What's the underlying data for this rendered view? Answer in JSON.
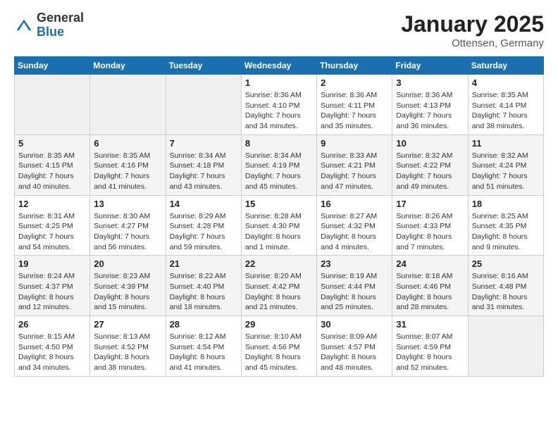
{
  "header": {
    "logo_general": "General",
    "logo_blue": "Blue",
    "title": "January 2025",
    "subtitle": "Ottensen, Germany"
  },
  "weekdays": [
    "Sunday",
    "Monday",
    "Tuesday",
    "Wednesday",
    "Thursday",
    "Friday",
    "Saturday"
  ],
  "weeks": [
    [
      {
        "day": "",
        "info": ""
      },
      {
        "day": "",
        "info": ""
      },
      {
        "day": "",
        "info": ""
      },
      {
        "day": "1",
        "info": "Sunrise: 8:36 AM\nSunset: 4:10 PM\nDaylight: 7 hours\nand 34 minutes."
      },
      {
        "day": "2",
        "info": "Sunrise: 8:36 AM\nSunset: 4:11 PM\nDaylight: 7 hours\nand 35 minutes."
      },
      {
        "day": "3",
        "info": "Sunrise: 8:36 AM\nSunset: 4:13 PM\nDaylight: 7 hours\nand 36 minutes."
      },
      {
        "day": "4",
        "info": "Sunrise: 8:35 AM\nSunset: 4:14 PM\nDaylight: 7 hours\nand 38 minutes."
      }
    ],
    [
      {
        "day": "5",
        "info": "Sunrise: 8:35 AM\nSunset: 4:15 PM\nDaylight: 7 hours\nand 40 minutes."
      },
      {
        "day": "6",
        "info": "Sunrise: 8:35 AM\nSunset: 4:16 PM\nDaylight: 7 hours\nand 41 minutes."
      },
      {
        "day": "7",
        "info": "Sunrise: 8:34 AM\nSunset: 4:18 PM\nDaylight: 7 hours\nand 43 minutes."
      },
      {
        "day": "8",
        "info": "Sunrise: 8:34 AM\nSunset: 4:19 PM\nDaylight: 7 hours\nand 45 minutes."
      },
      {
        "day": "9",
        "info": "Sunrise: 8:33 AM\nSunset: 4:21 PM\nDaylight: 7 hours\nand 47 minutes."
      },
      {
        "day": "10",
        "info": "Sunrise: 8:32 AM\nSunset: 4:22 PM\nDaylight: 7 hours\nand 49 minutes."
      },
      {
        "day": "11",
        "info": "Sunrise: 8:32 AM\nSunset: 4:24 PM\nDaylight: 7 hours\nand 51 minutes."
      }
    ],
    [
      {
        "day": "12",
        "info": "Sunrise: 8:31 AM\nSunset: 4:25 PM\nDaylight: 7 hours\nand 54 minutes."
      },
      {
        "day": "13",
        "info": "Sunrise: 8:30 AM\nSunset: 4:27 PM\nDaylight: 7 hours\nand 56 minutes."
      },
      {
        "day": "14",
        "info": "Sunrise: 8:29 AM\nSunset: 4:28 PM\nDaylight: 7 hours\nand 59 minutes."
      },
      {
        "day": "15",
        "info": "Sunrise: 8:28 AM\nSunset: 4:30 PM\nDaylight: 8 hours\nand 1 minute."
      },
      {
        "day": "16",
        "info": "Sunrise: 8:27 AM\nSunset: 4:32 PM\nDaylight: 8 hours\nand 4 minutes."
      },
      {
        "day": "17",
        "info": "Sunrise: 8:26 AM\nSunset: 4:33 PM\nDaylight: 8 hours\nand 7 minutes."
      },
      {
        "day": "18",
        "info": "Sunrise: 8:25 AM\nSunset: 4:35 PM\nDaylight: 8 hours\nand 9 minutes."
      }
    ],
    [
      {
        "day": "19",
        "info": "Sunrise: 8:24 AM\nSunset: 4:37 PM\nDaylight: 8 hours\nand 12 minutes."
      },
      {
        "day": "20",
        "info": "Sunrise: 8:23 AM\nSunset: 4:39 PM\nDaylight: 8 hours\nand 15 minutes."
      },
      {
        "day": "21",
        "info": "Sunrise: 8:22 AM\nSunset: 4:40 PM\nDaylight: 8 hours\nand 18 minutes."
      },
      {
        "day": "22",
        "info": "Sunrise: 8:20 AM\nSunset: 4:42 PM\nDaylight: 8 hours\nand 21 minutes."
      },
      {
        "day": "23",
        "info": "Sunrise: 8:19 AM\nSunset: 4:44 PM\nDaylight: 8 hours\nand 25 minutes."
      },
      {
        "day": "24",
        "info": "Sunrise: 8:18 AM\nSunset: 4:46 PM\nDaylight: 8 hours\nand 28 minutes."
      },
      {
        "day": "25",
        "info": "Sunrise: 8:16 AM\nSunset: 4:48 PM\nDaylight: 8 hours\nand 31 minutes."
      }
    ],
    [
      {
        "day": "26",
        "info": "Sunrise: 8:15 AM\nSunset: 4:50 PM\nDaylight: 8 hours\nand 34 minutes."
      },
      {
        "day": "27",
        "info": "Sunrise: 8:13 AM\nSunset: 4:52 PM\nDaylight: 8 hours\nand 38 minutes."
      },
      {
        "day": "28",
        "info": "Sunrise: 8:12 AM\nSunset: 4:54 PM\nDaylight: 8 hours\nand 41 minutes."
      },
      {
        "day": "29",
        "info": "Sunrise: 8:10 AM\nSunset: 4:56 PM\nDaylight: 8 hours\nand 45 minutes."
      },
      {
        "day": "30",
        "info": "Sunrise: 8:09 AM\nSunset: 4:57 PM\nDaylight: 8 hours\nand 48 minutes."
      },
      {
        "day": "31",
        "info": "Sunrise: 8:07 AM\nSunset: 4:59 PM\nDaylight: 8 hours\nand 52 minutes."
      },
      {
        "day": "",
        "info": ""
      }
    ]
  ]
}
